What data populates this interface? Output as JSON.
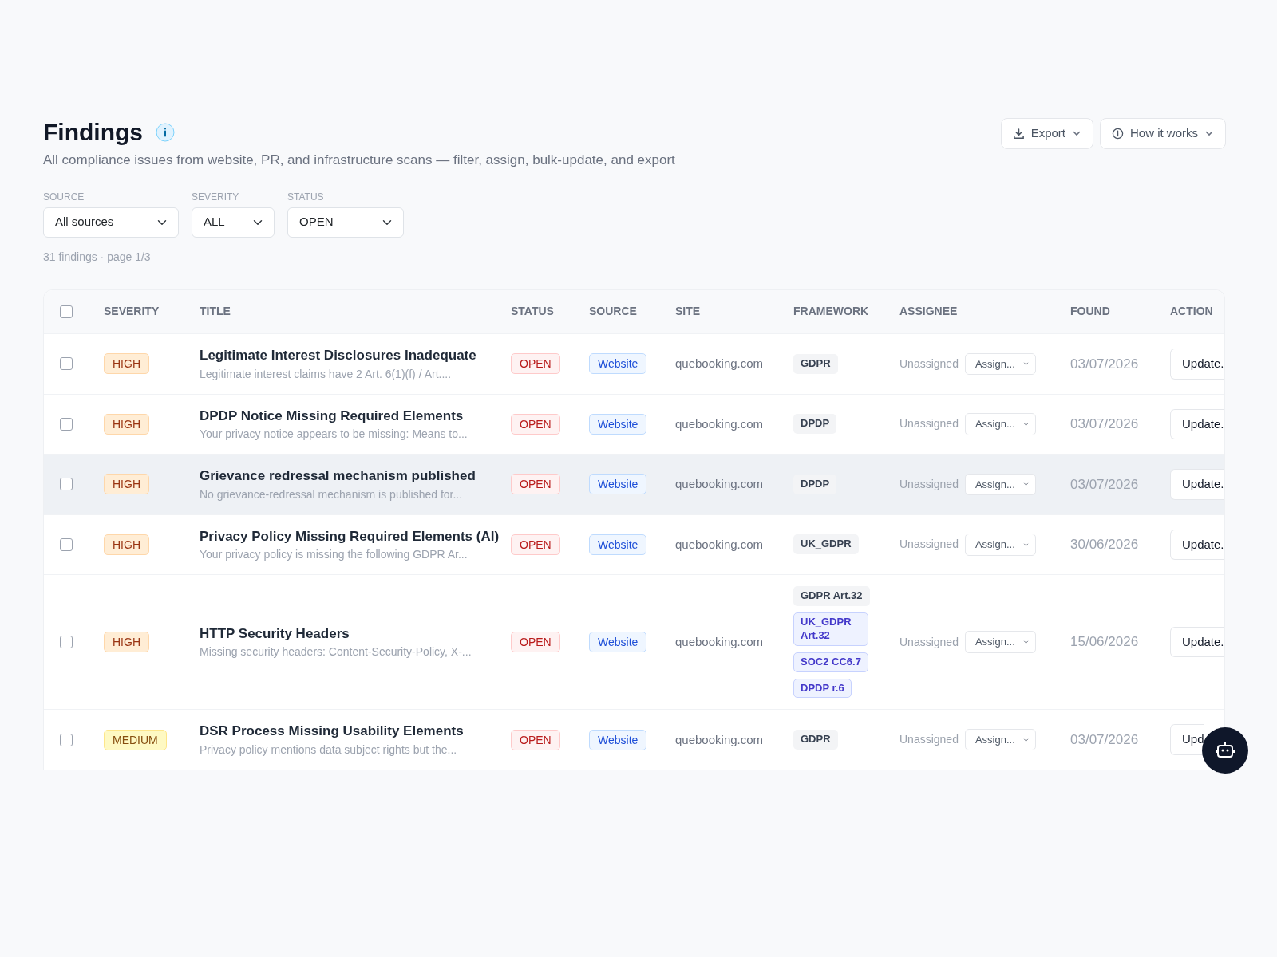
{
  "header": {
    "title": "Findings",
    "subtitle": "All compliance issues from website, PR, and infrastructure scans — filter, assign, bulk-update, and export",
    "buttons": [
      {
        "label": "Export",
        "kind": "download"
      },
      {
        "label": "How it works",
        "kind": "info"
      }
    ]
  },
  "filters": [
    {
      "label": "SOURCE",
      "value": "All sources"
    },
    {
      "label": "SEVERITY",
      "value": "ALL"
    },
    {
      "label": "STATUS",
      "value": "OPEN"
    }
  ],
  "count": "31 findings · page 1/3",
  "table": {
    "select_all": {
      "checked": false
    },
    "columns": [
      "SEVERITY",
      "TITLE",
      "STATUS",
      "SOURCE",
      "SITE",
      "FRAMEWORK",
      "ASSIGNEE",
      "FOUND",
      "ACTION"
    ],
    "rows": [
      {
        "checked": false,
        "hovered": false,
        "severity": {
          "label": "HIGH",
          "kind": "high"
        },
        "title": "Legitimate Interest Disclosures Inadequate",
        "description": "Legitimate interest claims have 2 Art. 6(1)(f) / Art....",
        "status": "OPEN",
        "source": "Website",
        "site": "quebooking.com",
        "frameworks": [
          {
            "label": "GDPR",
            "kind": "plain"
          }
        ],
        "assignee": "Unassigned",
        "assign": "Assign...",
        "found": "03/07/2026",
        "action": "Update.."
      },
      {
        "checked": false,
        "hovered": false,
        "severity": {
          "label": "HIGH",
          "kind": "high"
        },
        "title": "DPDP Notice Missing Required Elements",
        "description": "Your privacy notice appears to be missing: Means to...",
        "status": "OPEN",
        "source": "Website",
        "site": "quebooking.com",
        "frameworks": [
          {
            "label": "DPDP",
            "kind": "plain"
          }
        ],
        "assignee": "Unassigned",
        "assign": "Assign...",
        "found": "03/07/2026",
        "action": "Update.."
      },
      {
        "checked": false,
        "hovered": true,
        "severity": {
          "label": "HIGH",
          "kind": "high"
        },
        "title": "Grievance redressal mechanism published",
        "description": "No grievance-redressal mechanism is published for...",
        "status": "OPEN",
        "source": "Website",
        "site": "quebooking.com",
        "frameworks": [
          {
            "label": "DPDP",
            "kind": "plain"
          }
        ],
        "assignee": "Unassigned",
        "assign": "Assign...",
        "found": "03/07/2026",
        "action": "Update.."
      },
      {
        "checked": false,
        "hovered": false,
        "severity": {
          "label": "HIGH",
          "kind": "high"
        },
        "title": "Privacy Policy Missing Required Elements (AI)",
        "description": "Your privacy policy is missing the following GDPR Ar...",
        "status": "OPEN",
        "source": "Website",
        "site": "quebooking.com",
        "frameworks": [
          {
            "label": "UK_GDPR",
            "kind": "plain"
          }
        ],
        "assignee": "Unassigned",
        "assign": "Assign...",
        "found": "30/06/2026",
        "action": "Update.."
      },
      {
        "checked": false,
        "hovered": false,
        "severity": {
          "label": "HIGH",
          "kind": "high"
        },
        "title": "HTTP Security Headers",
        "description": "Missing security headers: Content-Security-Policy, X-...",
        "status": "OPEN",
        "source": "Website",
        "site": "quebooking.com",
        "frameworks": [
          {
            "label": "GDPR Art.32",
            "kind": "plain"
          },
          {
            "label": "UK_GDPR Art.32",
            "kind": "mapped"
          },
          {
            "label": "SOC2 CC6.7",
            "kind": "mapped"
          },
          {
            "label": "DPDP r.6",
            "kind": "mapped"
          }
        ],
        "assignee": "Unassigned",
        "assign": "Assign...",
        "found": "15/06/2026",
        "action": "Update.."
      },
      {
        "checked": false,
        "hovered": false,
        "severity": {
          "label": "MEDIUM",
          "kind": "medium"
        },
        "title": "DSR Process Missing Usability Elements",
        "description": "Privacy policy mentions data subject rights but the...",
        "status": "OPEN",
        "source": "Website",
        "site": "quebooking.com",
        "frameworks": [
          {
            "label": "GDPR",
            "kind": "plain"
          }
        ],
        "assignee": "Unassigned",
        "assign": "Assign...",
        "found": "03/07/2026",
        "action": "Upd"
      }
    ]
  }
}
